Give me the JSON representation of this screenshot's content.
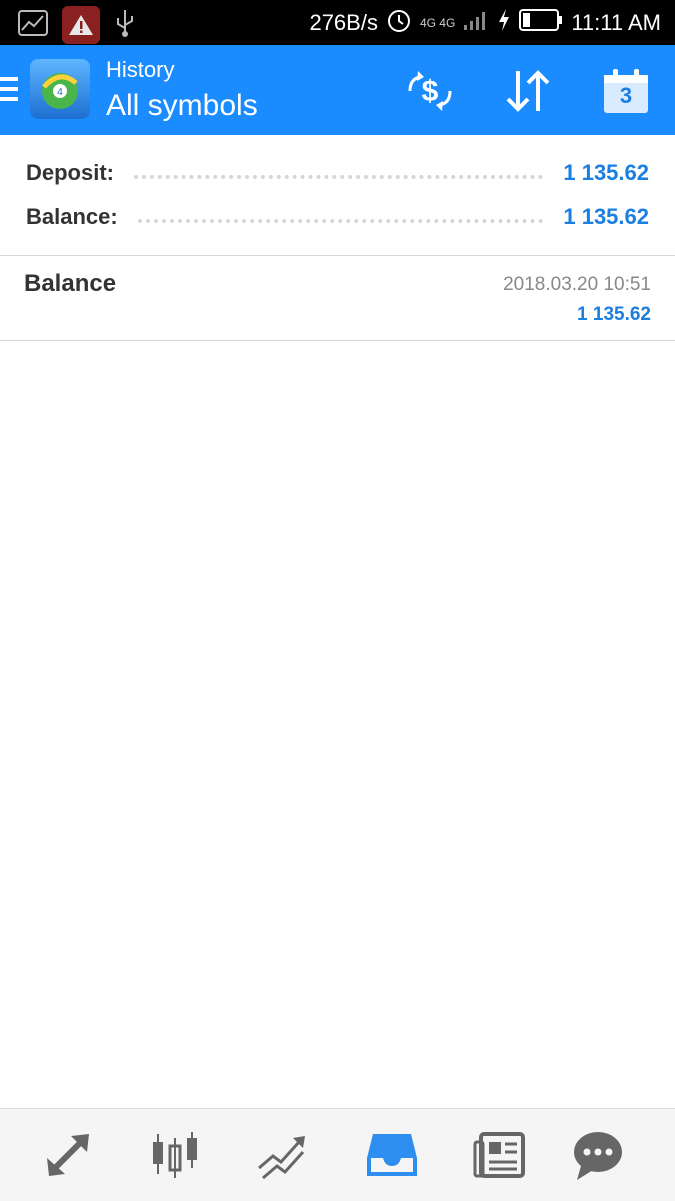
{
  "status_bar": {
    "speed": "276B/s",
    "network": "4G 4G",
    "time": "11:11 AM"
  },
  "app_bar": {
    "title": "History",
    "subtitle": "All symbols",
    "calendar_day": "3",
    "accent": "#1a8cff"
  },
  "summary": {
    "rows": [
      {
        "label": "Deposit:",
        "value": "1 135.62"
      },
      {
        "label": "Balance:",
        "value": "1 135.62"
      }
    ]
  },
  "deals": [
    {
      "type": "Balance",
      "time": "2018.03.20 10:51",
      "amount": "1 135.62"
    }
  ],
  "bottom_nav": {
    "items": [
      {
        "icon": "trade-arrows-icon",
        "active": false
      },
      {
        "icon": "candlestick-chart-icon",
        "active": false
      },
      {
        "icon": "trend-lines-icon",
        "active": false
      },
      {
        "icon": "history-inbox-icon",
        "active": true
      },
      {
        "icon": "news-icon",
        "active": false
      },
      {
        "icon": "chat-icon",
        "active": false
      }
    ]
  }
}
